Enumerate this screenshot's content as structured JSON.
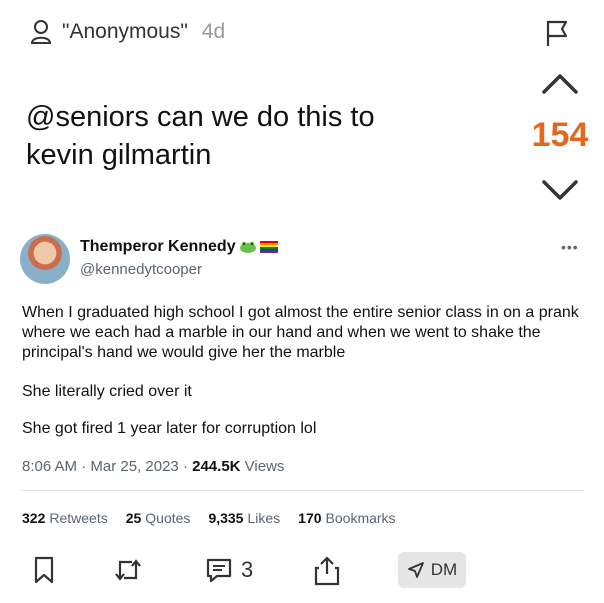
{
  "post": {
    "author": "\"Anonymous\"",
    "age": "4d",
    "text_line1": "@seniors can we do this to",
    "text_line2": "kevin gilmartin",
    "votes": "154"
  },
  "tweet": {
    "display_name": "Themperor Kennedy",
    "handle": "@kennedytcooper",
    "paragraph1": "When I graduated high school I got almost the entire senior class in on a prank where we each had a marble in our hand and when we went to shake the principal's hand we would give her the marble",
    "paragraph2": "She literally cried over it",
    "paragraph3": "She got fired 1 year later for corruption lol",
    "time": "8:06 AM",
    "date": "Mar 25, 2023",
    "views_count": "244.5K",
    "views_label": "Views",
    "retweets_count": "322",
    "retweets_label": "Retweets",
    "quotes_count": "25",
    "quotes_label": "Quotes",
    "likes_count": "9,335",
    "likes_label": "Likes",
    "bookmarks_count": "170",
    "bookmarks_label": "Bookmarks"
  },
  "actions": {
    "comment_count": "3",
    "dm_label": "DM"
  },
  "colors": {
    "vote_accent": "#e0691f"
  }
}
